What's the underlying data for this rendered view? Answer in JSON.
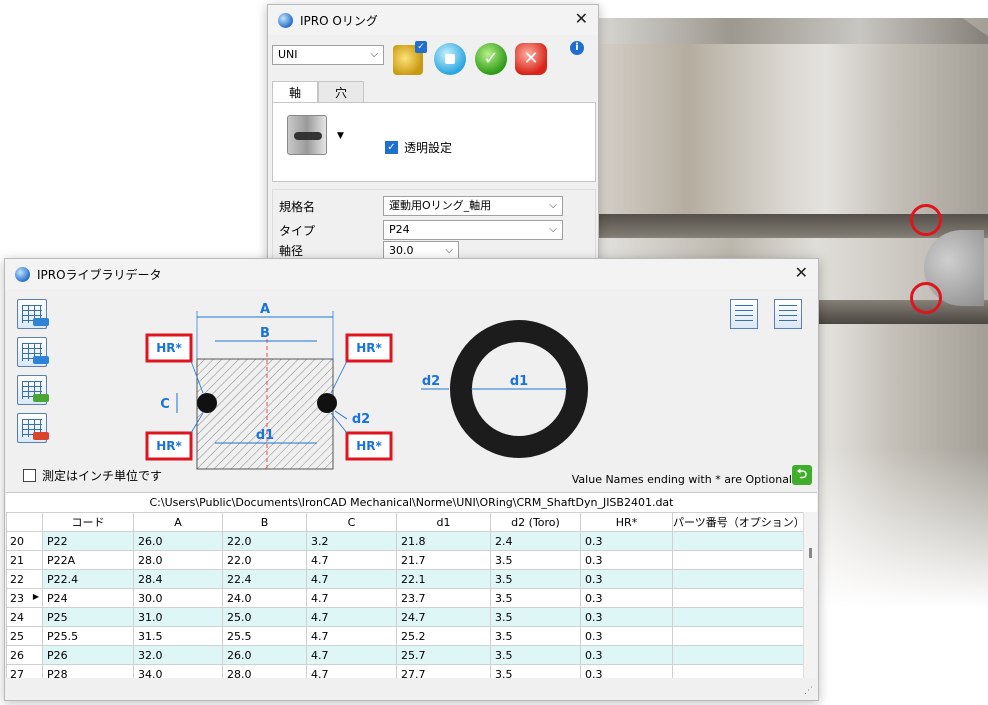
{
  "oring_dialog": {
    "title": "IPRO Oリング",
    "standard_select": "UNI",
    "tabs": [
      {
        "label": "軸"
      },
      {
        "label": "穴"
      }
    ],
    "transparent_label": "透明設定",
    "params": [
      {
        "label": "規格名",
        "value": "運動用Oリング_軸用"
      },
      {
        "label": "タイプ",
        "value": "P24"
      },
      {
        "label": "軸径",
        "value": "30.0"
      }
    ]
  },
  "library_dialog": {
    "title": "IPROライブラリデータ",
    "diagram_labels": {
      "a": "A",
      "b": "B",
      "c": "C",
      "d1": "d1",
      "d2": "d2",
      "hr": "HR*",
      "ring_d1": "d1",
      "ring_d2": "d2"
    },
    "inch_label": "測定はインチ単位です",
    "optional_note": "Value Names ending with * are Optional",
    "file_path": "C:\\Users\\Public\\Documents\\IronCAD Mechanical\\Norme\\UNI\\ORing\\CRM_ShaftDyn_JISB2401.dat",
    "columns": [
      "コード",
      "A",
      "B",
      "C",
      "d1",
      "d2 (Toro)",
      "HR*",
      "パーツ番号（オプション）"
    ],
    "rows": [
      {
        "n": "20",
        "code": "P22",
        "a": "26.0",
        "b": "22.0",
        "c": "3.2",
        "d1": "21.8",
        "d2": "2.4",
        "hr": "0.3",
        "part": ""
      },
      {
        "n": "21",
        "code": "P22A",
        "a": "28.0",
        "b": "22.0",
        "c": "4.7",
        "d1": "21.7",
        "d2": "3.5",
        "hr": "0.3",
        "part": ""
      },
      {
        "n": "22",
        "code": "P22.4",
        "a": "28.4",
        "b": "22.4",
        "c": "4.7",
        "d1": "22.1",
        "d2": "3.5",
        "hr": "0.3",
        "part": ""
      },
      {
        "n": "23",
        "code": "P24",
        "a": "30.0",
        "b": "24.0",
        "c": "4.7",
        "d1": "23.7",
        "d2": "3.5",
        "hr": "0.3",
        "part": "",
        "current": true
      },
      {
        "n": "24",
        "code": "P25",
        "a": "31.0",
        "b": "25.0",
        "c": "4.7",
        "d1": "24.7",
        "d2": "3.5",
        "hr": "0.3",
        "part": ""
      },
      {
        "n": "25",
        "code": "P25.5",
        "a": "31.5",
        "b": "25.5",
        "c": "4.7",
        "d1": "25.2",
        "d2": "3.5",
        "hr": "0.3",
        "part": ""
      },
      {
        "n": "26",
        "code": "P26",
        "a": "32.0",
        "b": "26.0",
        "c": "4.7",
        "d1": "25.7",
        "d2": "3.5",
        "hr": "0.3",
        "part": ""
      },
      {
        "n": "27",
        "code": "P28",
        "a": "34.0",
        "b": "28.0",
        "c": "4.7",
        "d1": "27.7",
        "d2": "3.5",
        "hr": "0.3",
        "part": ""
      }
    ]
  },
  "colors": {
    "accent_blue": "#1f6fd1",
    "highlight_red": "#e0141e",
    "row_alt": "#dff6f6"
  }
}
